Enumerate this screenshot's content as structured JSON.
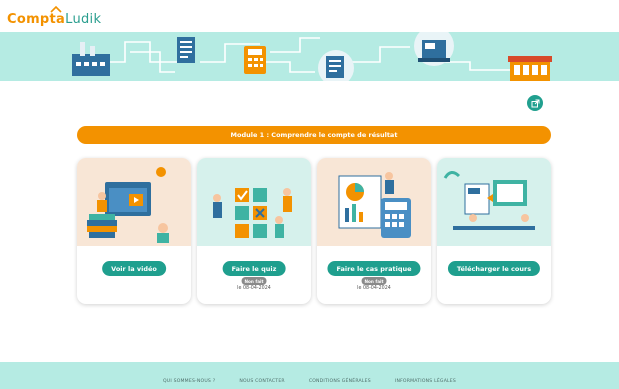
{
  "logo": {
    "part1": "Compta",
    "part2": "Ludik"
  },
  "module": {
    "title": "Module 1 : Comprendre le compte de résultat"
  },
  "cards": [
    {
      "button": "Voir la vidéo"
    },
    {
      "button": "Faire le quiz",
      "badge": "Non fait",
      "date": "le 08-04-2024"
    },
    {
      "button": "Faire le cas pratique",
      "badge": "Non fait",
      "date": "le 08-04-2024"
    },
    {
      "button": "Télécharger le cours"
    }
  ],
  "footer": {
    "links": [
      "QUI SOMMES-NOUS ?",
      "NOUS CONTACTER",
      "CONDITIONS GÉNÉRALES",
      "INFORMATIONS LÉGALES"
    ]
  },
  "colors": {
    "accent": "#f39200",
    "teal": "#1f9f8e",
    "mint": "#b5ebe3"
  },
  "icons": {
    "external": "external-link-icon"
  }
}
